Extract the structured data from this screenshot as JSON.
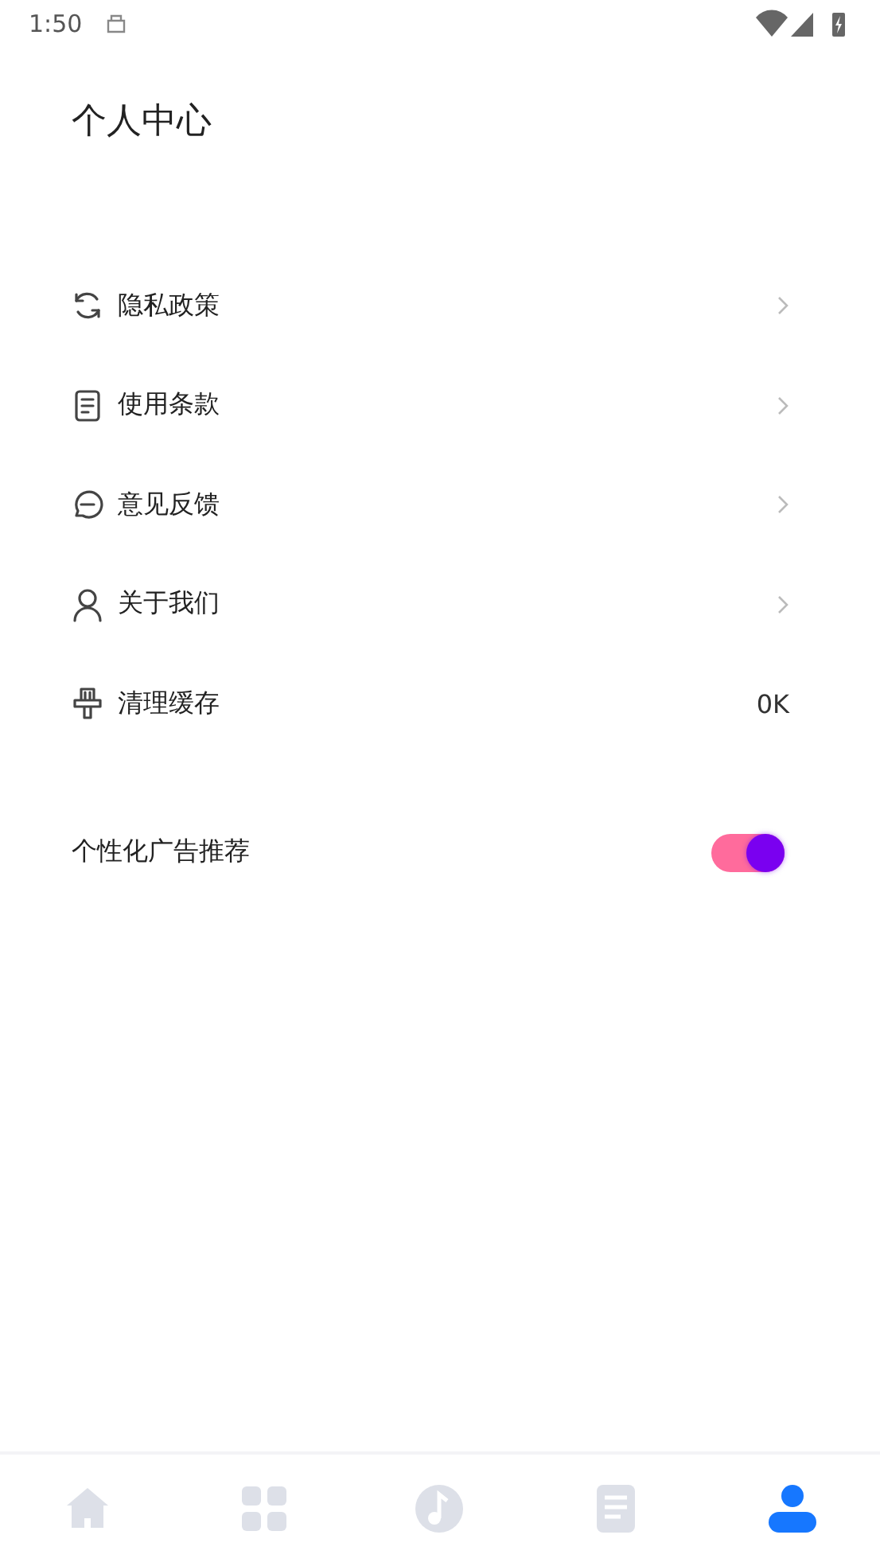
{
  "status_bar": {
    "time": "1:50"
  },
  "title": "个人中心",
  "menu": [
    {
      "kind": "link",
      "label": "隐私政策"
    },
    {
      "kind": "link",
      "label": "使用条款"
    },
    {
      "kind": "link",
      "label": "意见反馈"
    },
    {
      "kind": "link",
      "label": "关于我们"
    },
    {
      "kind": "value",
      "label": "清理缓存",
      "value": "0K"
    }
  ],
  "ad_setting": {
    "label": "个性化广告推荐",
    "on": true
  },
  "tab_bar": [
    {
      "selected": false
    },
    {
      "selected": false
    },
    {
      "selected": false
    },
    {
      "selected": false
    },
    {
      "selected": true
    }
  ]
}
